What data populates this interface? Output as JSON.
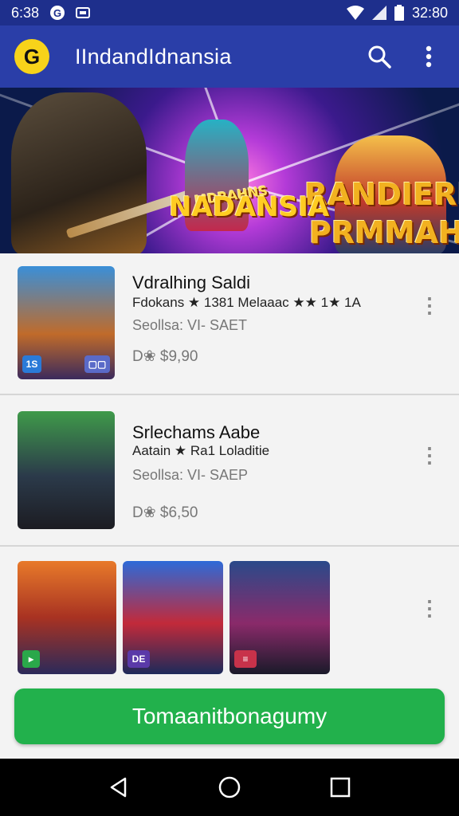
{
  "status": {
    "left_time": "6:38",
    "right_time": "32:80"
  },
  "appbar": {
    "title": "IIndandIdnansia",
    "logo_glyph": "G",
    "search_icon": "search-icon",
    "more_icon": "more-vert-icon"
  },
  "banner": {
    "line1": "RANDIERI",
    "line2": "PRMMAH",
    "center": "NADANSIA",
    "small": "MDRAHNS"
  },
  "items": [
    {
      "name": "Vdralhing Saldi",
      "meta": "Fdokans ★ 1381 Melaaac ★★ 1★ 1A",
      "sub": "Seollsa: VI- SAET",
      "price": "D❀ $9,90"
    },
    {
      "name": "Srlechams Aabe",
      "meta": "Aatain ★ Ra1 Loladitie",
      "sub": "Seollsa: VI- SAEP",
      "price": "D❀ $6,50"
    }
  ],
  "thumb_tags": [
    "1S",
    "▢▢",
    "▸",
    "DE",
    "≡"
  ],
  "cta": {
    "label": "Tomaanitbonagumy"
  },
  "colors": {
    "appbar": "#2a3ea8",
    "statusbar": "#1e2f8c",
    "cta": "#22b14c",
    "logo": "#f7d31a"
  }
}
